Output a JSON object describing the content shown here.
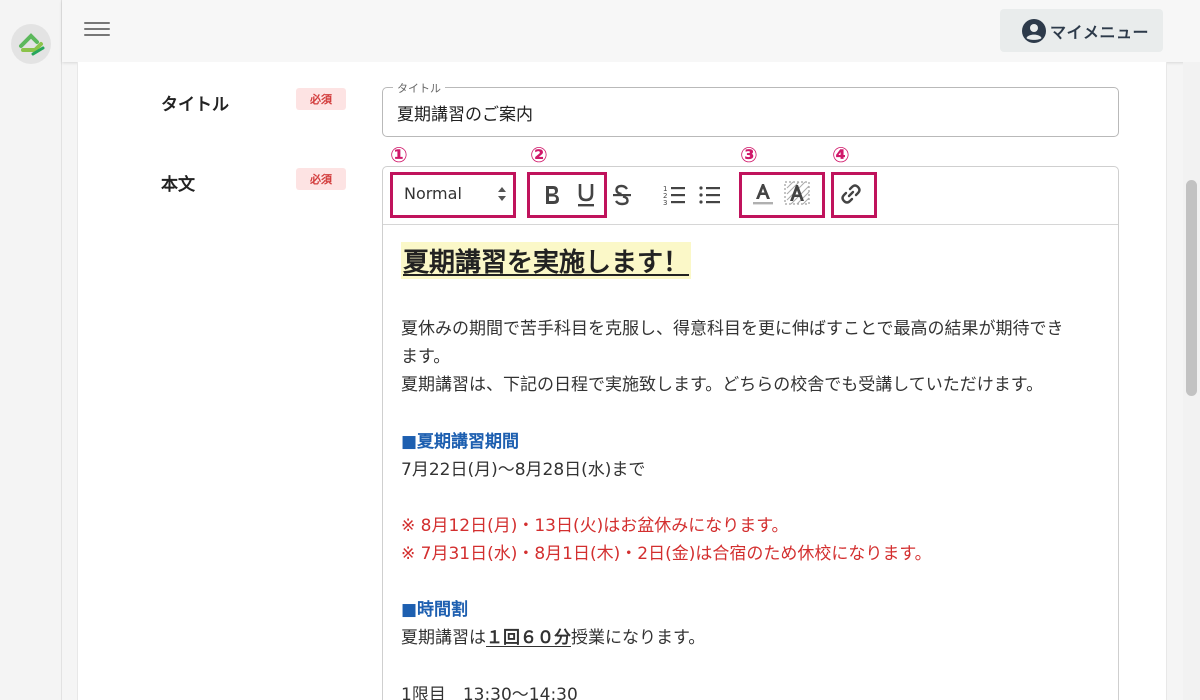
{
  "header": {
    "mymenu_label": "マイメニュー"
  },
  "form": {
    "title_label": "タイトル",
    "title_required": "必須",
    "title_legend": "タイトル",
    "title_value": "夏期講習のご案内",
    "body_label": "本文",
    "body_required": "必須"
  },
  "toolbar": {
    "format_value": "Normal",
    "markers": [
      "①",
      "②",
      "③",
      "④"
    ],
    "highlight_color": "#c0135c"
  },
  "content": {
    "heading": "夏期講習を実施します！",
    "para1_line1": "夏休みの期間で苦手科目を克服し、得意科目を更に伸ばすことで最高の結果が期待でき",
    "para1_line2": "ます。",
    "para2": "夏期講習は、下記の日程で実施致します。どちらの校舎でも受講していただけます。",
    "period_heading": "■夏期講習期間",
    "period_value": "7月22日(月)～8月28日(水)まで",
    "note1": "※ 8月12日(月)・13日(火)はお盆休みになります。",
    "note2": "※ 7月31日(水)・8月1日(木)・2日(金)は合宿のため休校になります。",
    "schedule_heading": "■時間割",
    "schedule_pre": "夏期講習は",
    "schedule_emph": "１回６０分",
    "schedule_post": "授業になります。",
    "period1": "1限目　13:30～14:30"
  },
  "colors": {
    "accent_pink": "#c0135c",
    "heading_blue": "#1d5fb0",
    "note_red": "#d32f2f",
    "required_bg": "#fde3e3"
  }
}
